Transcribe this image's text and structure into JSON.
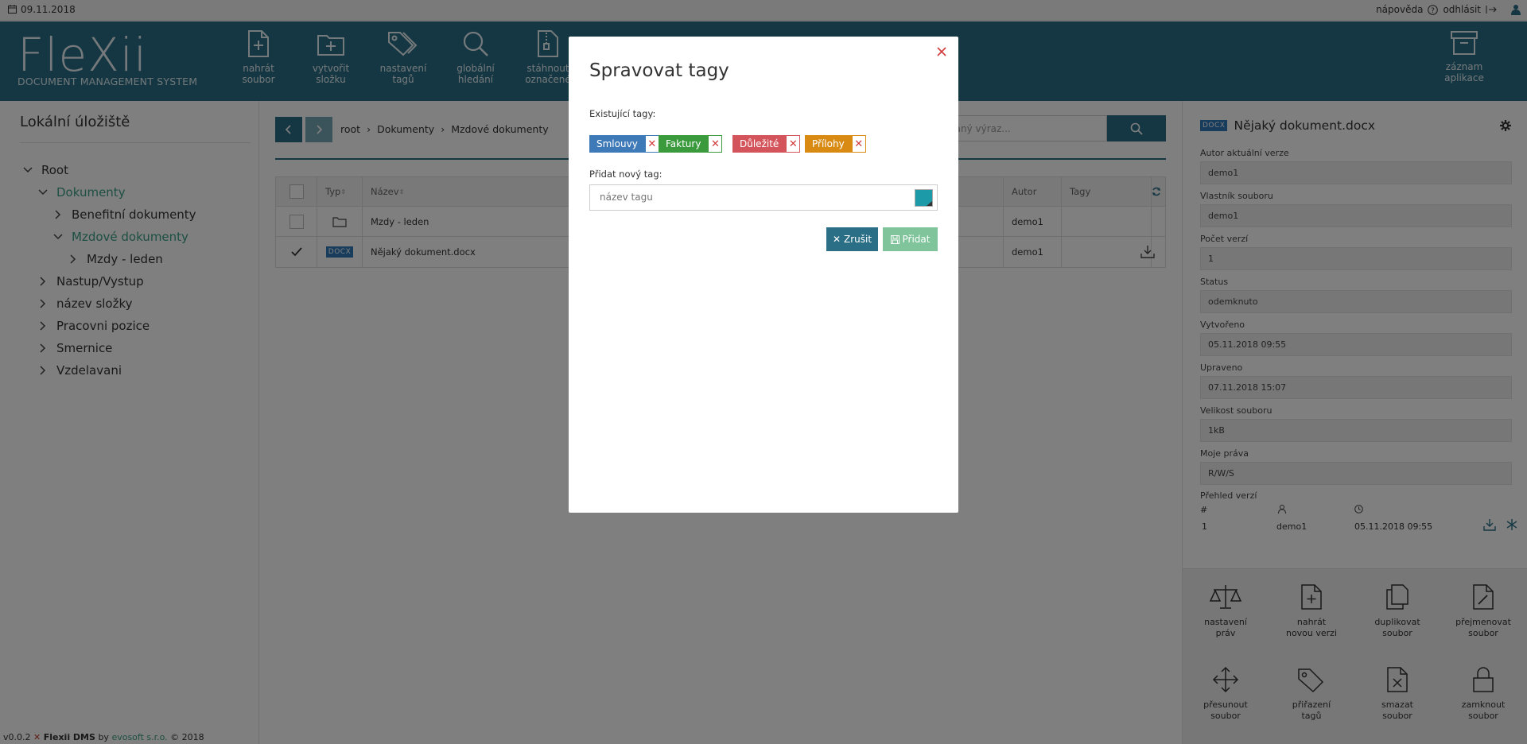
{
  "topbar": {
    "date": "09.11.2018",
    "help_label": "nápověda",
    "logout_label": "odhlásit"
  },
  "header": {
    "logo_text": "FleXii",
    "logo_subtitle": "DOCUMENT MANAGEMENT SYSTEM",
    "tools": [
      {
        "line1": "nahrát",
        "line2": "soubor",
        "icon": "file-plus-icon"
      },
      {
        "line1": "vytvořit",
        "line2": "složku",
        "icon": "folder-plus-icon"
      },
      {
        "line1": "nastavení",
        "line2": "tagů",
        "icon": "tags-icon"
      },
      {
        "line1": "globální",
        "line2": "hledání",
        "icon": "search-icon"
      },
      {
        "line1": "stáhnout",
        "line2": "označené",
        "icon": "zip-icon"
      }
    ],
    "log_tool": {
      "line1": "záznam",
      "line2": "aplikace",
      "icon": "archive-icon"
    }
  },
  "sidebar": {
    "title": "Lokální úložiště",
    "tree": [
      {
        "label": "Root"
      },
      {
        "label": "Dokumenty"
      },
      {
        "label": "Benefitní dokumenty"
      },
      {
        "label": "Mzdové dokumenty"
      },
      {
        "label": "Mzdy - leden"
      },
      {
        "label": "Nastup/Vystup"
      },
      {
        "label": "název složky"
      },
      {
        "label": "Pracovni pozice"
      },
      {
        "label": "Smernice"
      },
      {
        "label": "Vzdelavani"
      }
    ]
  },
  "footer": {
    "version": "v0.0.2",
    "product": "Flexii DMS",
    "by": "by",
    "company": "evosoft s.r.o.",
    "copyright": "© 2018"
  },
  "main": {
    "breadcrumb": [
      "root",
      "Dokumenty",
      "Mzdové dokumenty"
    ],
    "search_placeholder": "daný výraz...",
    "columns": {
      "type": "Typ",
      "name": "Název",
      "author": "Autor",
      "tags": "Tagy"
    },
    "rows": [
      {
        "name": "Mzdy - leden",
        "author": "demo1",
        "type": "folder"
      },
      {
        "name": "Nějaký dokument.docx",
        "author": "demo1",
        "type": "DOCX"
      }
    ]
  },
  "details": {
    "badge": "DOCX",
    "filename": "Nějaký dokument.docx",
    "fields": [
      {
        "label": "Autor aktuální verze",
        "value": "demo1"
      },
      {
        "label": "Vlastník souboru",
        "value": "demo1"
      },
      {
        "label": "Počet verzí",
        "value": "1"
      },
      {
        "label": "Status",
        "value": "odemknuto"
      },
      {
        "label": "Vytvořeno",
        "value": "05.11.2018 09:55"
      },
      {
        "label": "Upraveno",
        "value": "07.11.2018 15:07"
      },
      {
        "label": "Velikost souboru",
        "value": "1kB"
      },
      {
        "label": "Moje práva",
        "value": "R/W/S"
      }
    ],
    "versions_title": "Přehled verzí",
    "versions_hash": "#",
    "version_row": {
      "num": "1",
      "user": "demo1",
      "date": "05.11.2018 09:55"
    },
    "actions": [
      {
        "line1": "nastavení",
        "line2": "práv"
      },
      {
        "line1": "nahrát",
        "line2": "novou verzi"
      },
      {
        "line1": "duplikovat",
        "line2": "soubor"
      },
      {
        "line1": "přejmenovat",
        "line2": "soubor"
      },
      {
        "line1": "přesunout",
        "line2": "soubor"
      },
      {
        "line1": "přiřazení",
        "line2": "tagů"
      },
      {
        "line1": "smazat",
        "line2": "soubor"
      },
      {
        "line1": "zamknout",
        "line2": "soubor"
      }
    ]
  },
  "modal": {
    "title": "Spravovat tagy",
    "existing_label": "Existující tagy:",
    "tags": [
      {
        "name": "Smlouvy",
        "color": "#3f7ab8"
      },
      {
        "name": "Faktury",
        "color": "#3a9a3c"
      },
      {
        "name": "Důležité",
        "color": "#d4545c"
      },
      {
        "name": "Přílohy",
        "color": "#d98a12"
      }
    ],
    "new_label": "Přidat nový tag:",
    "new_placeholder": "název tagu",
    "swatch_color": "#1d9aa8",
    "cancel_label": "Zrušit",
    "add_label": "Přidat"
  },
  "colors": {
    "brand": "#2b6f86",
    "accent": "#3a9e84"
  }
}
